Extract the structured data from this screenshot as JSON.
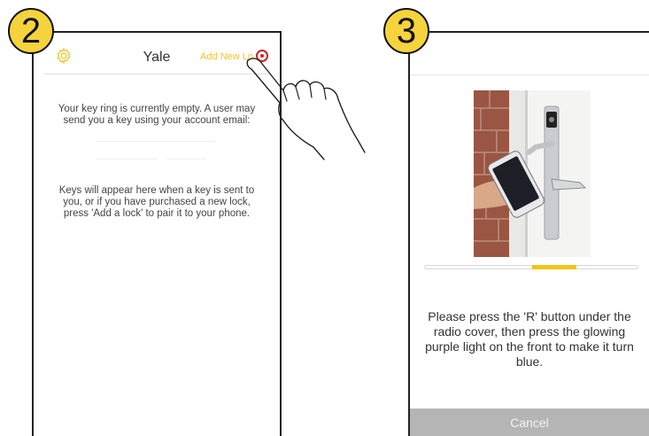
{
  "steps": {
    "step2": "2",
    "step3": "3"
  },
  "screen2": {
    "title": "Yale",
    "add_new_lock": "Add New Lo",
    "empty_message": "Your key ring is currently empty. A user may send you a key using your account email:",
    "help_message": "Keys will appear here when a key is sent to you, or if you have purchased a new lock, press 'Add a lock' to pair it to your phone.",
    "settings_icon": "gear-icon"
  },
  "screen3": {
    "progress": 0.25,
    "instruction": "Please press the 'R' button under the radio cover, then press the glowing purple light on the front to make it turn blue.",
    "cancel_label": "Cancel"
  },
  "colors": {
    "accent_yellow": "#f5d33d",
    "tap_indicator": "#cc2222",
    "cancel_bar": "#b5b5b5"
  }
}
